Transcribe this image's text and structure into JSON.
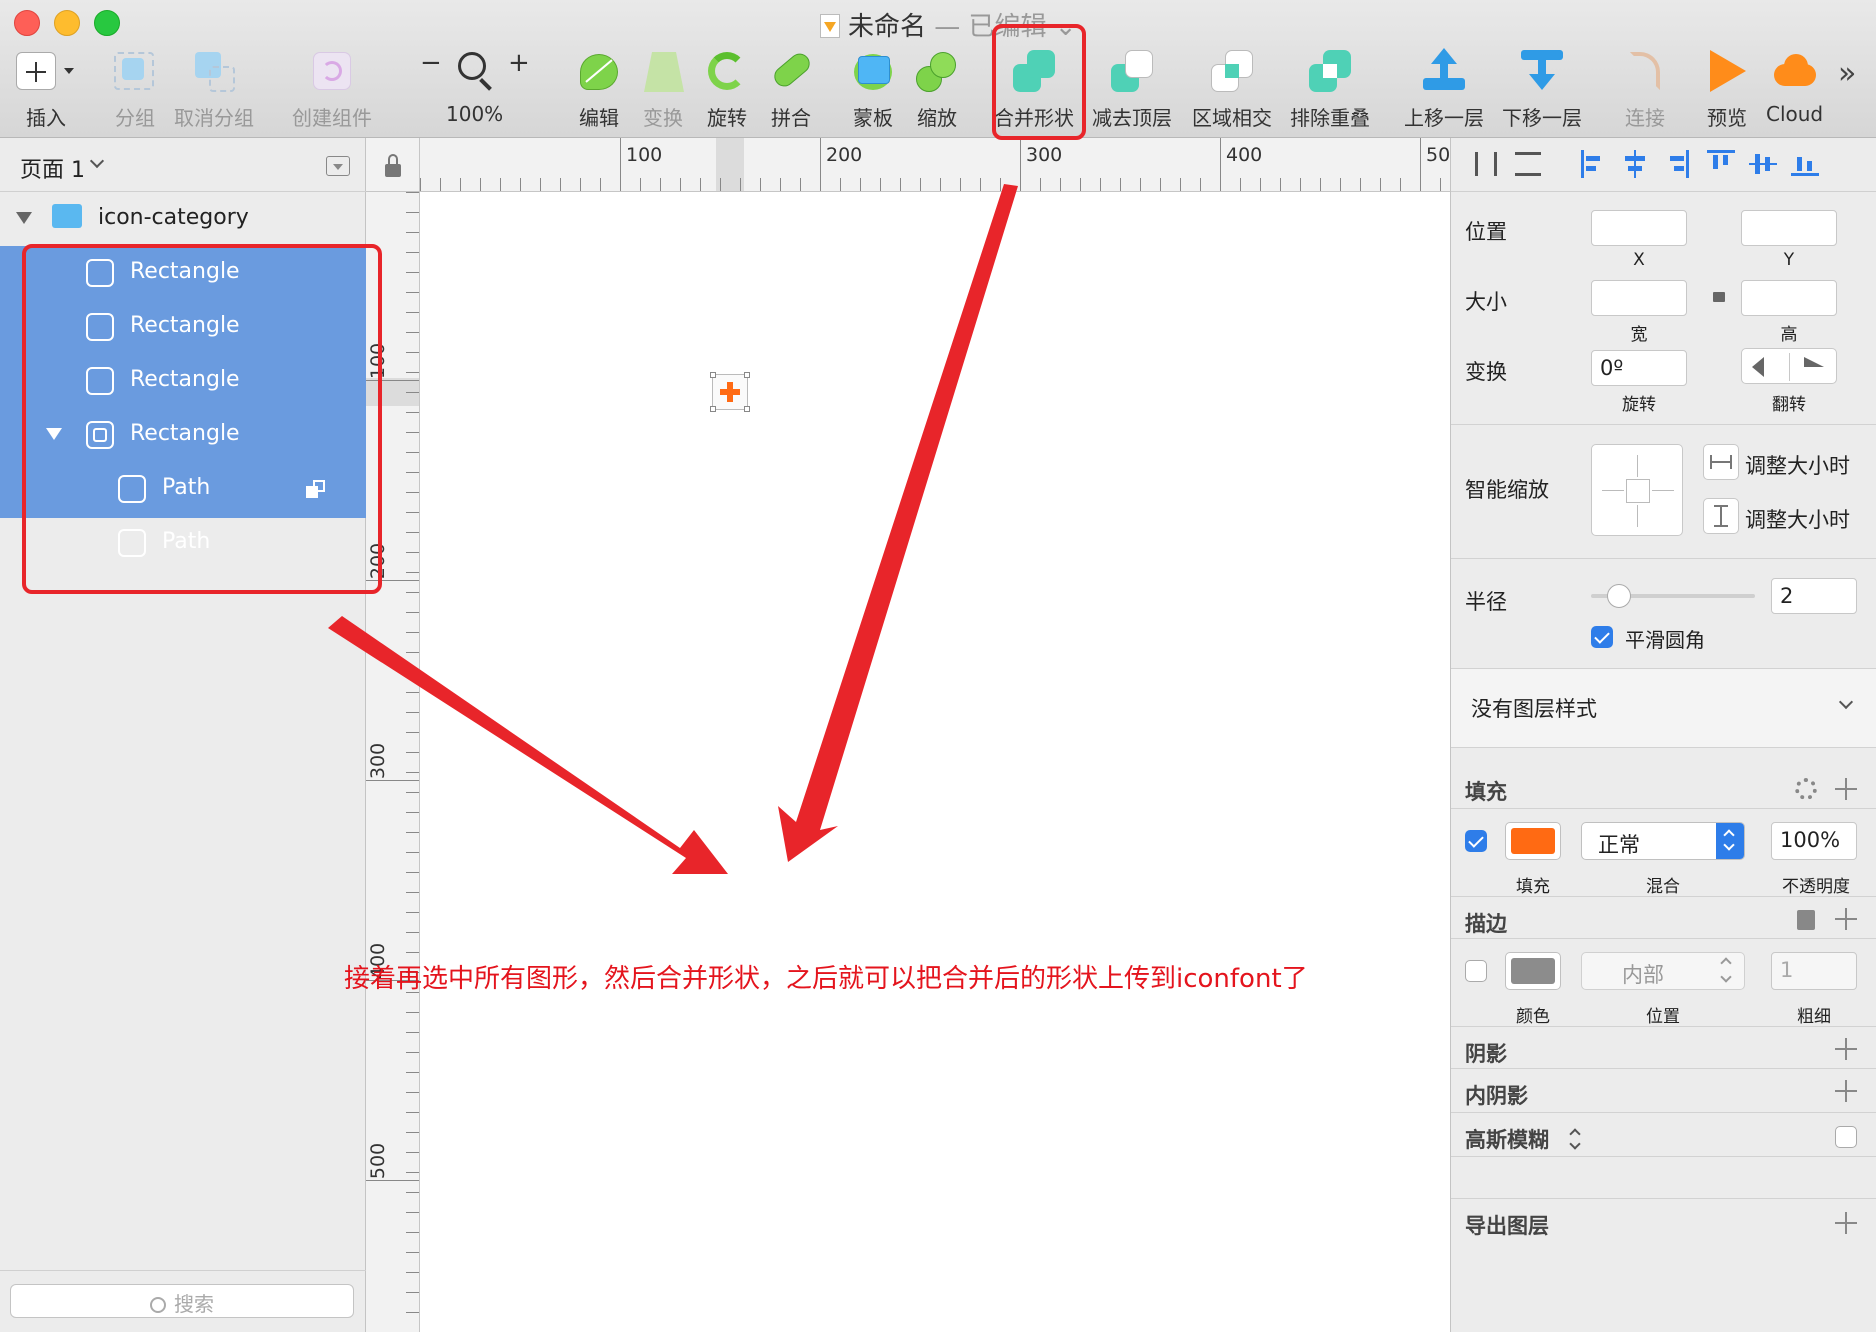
{
  "window": {
    "title": "未命名",
    "title_suffix": "— 已编辑 ⌄"
  },
  "toolbar": {
    "insert": "插入",
    "group": "分组",
    "ungroup": "取消分组",
    "create_symbol": "创建组件",
    "zoom_minus": "−",
    "zoom_plus": "+",
    "zoom_level": "100%",
    "edit": "编辑",
    "transform": "变换",
    "rotate": "旋转",
    "flatten": "拼合",
    "mask": "蒙板",
    "scale": "缩放",
    "union": "合并形状",
    "subtract": "减去顶层",
    "intersect": "区域相交",
    "difference": "排除重叠",
    "forward": "上移一层",
    "backward": "下移一层",
    "link": "连接",
    "preview": "预览",
    "cloud": "Cloud",
    "more": "»"
  },
  "pages": {
    "current": "页面 1"
  },
  "layers": {
    "group_name": "icon-category",
    "items": [
      {
        "name": "Rectangle"
      },
      {
        "name": "Rectangle"
      },
      {
        "name": "Rectangle"
      },
      {
        "name": "Rectangle"
      },
      {
        "name": "Path"
      },
      {
        "name": "Path"
      }
    ],
    "search_placeholder": "搜索"
  },
  "rulers": {
    "top": [
      "100",
      "200",
      "300",
      "400",
      "50"
    ],
    "left": [
      "100",
      "200",
      "300",
      "400",
      "500"
    ]
  },
  "inspector": {
    "position_label": "位置",
    "x_label": "X",
    "y_label": "Y",
    "size_label": "大小",
    "width_label": "宽",
    "height_label": "高",
    "transform_label": "变换",
    "rotate_value": "0º",
    "rotate_label": "旋转",
    "flip_label": "翻转",
    "smart_resize_label": "智能缩放",
    "resize_option_1": "调整大小时",
    "resize_option_2": "调整大小时",
    "radius_label": "半径",
    "radius_value": "2",
    "smooth_corners_label": "平滑圆角",
    "smooth_corners_checked": true,
    "style_label": "没有图层样式",
    "fill_section": "填充",
    "fill_enabled": true,
    "fill_color": "#ff6a13",
    "fill_label": "填充",
    "blend_value": "正常",
    "blend_label": "混合",
    "opacity_value": "100%",
    "opacity_label": "不透明度",
    "border_section": "描边",
    "border_enabled": false,
    "border_color": "#8c8c8c",
    "border_color_label": "颜色",
    "border_position_value": "内部",
    "border_position_label": "位置",
    "border_thickness_value": "1",
    "border_thickness_label": "粗细",
    "shadow_section": "阴影",
    "inner_shadow_section": "内阴影",
    "blur_section": "高斯模糊",
    "export_section": "导出图层"
  },
  "annotation": {
    "text": "接着再选中所有图形，然后合并形状，之后就可以把合并后的形状上传到iconfont了",
    "color": "#e4141d"
  }
}
